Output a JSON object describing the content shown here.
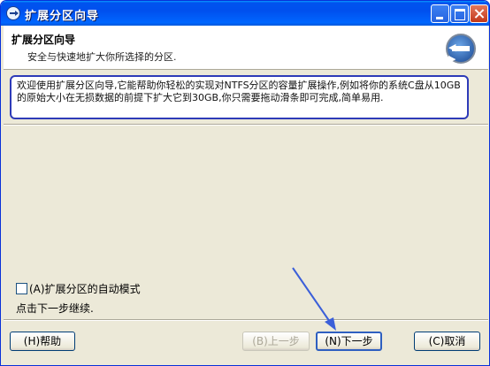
{
  "window": {
    "title": "扩展分区向导"
  },
  "header": {
    "title": "扩展分区向导",
    "subtitle": "安全与快速地扩大你所选择的分区."
  },
  "description": "欢迎使用扩展分区向导,它能帮助你轻松的实现对NTFS分区的容量扩展操作,例如将你的系统C盘从10GB的原始大小在无损数据的前提下扩大它到30GB,你只需要拖动滑条即可完成,简单易用.",
  "auto_mode": {
    "label": "(A)扩展分区的自动模式",
    "checked": false
  },
  "hint": "点击下一步继续.",
  "buttons": {
    "help": "(H)帮助",
    "prev": "(B)上一步",
    "next": "(N)下一步",
    "cancel": "(C)取消"
  },
  "colors": {
    "titlebar": "#0053ee",
    "highlight_border": "#2e3bb8",
    "arrow": "#3b5fd9"
  }
}
